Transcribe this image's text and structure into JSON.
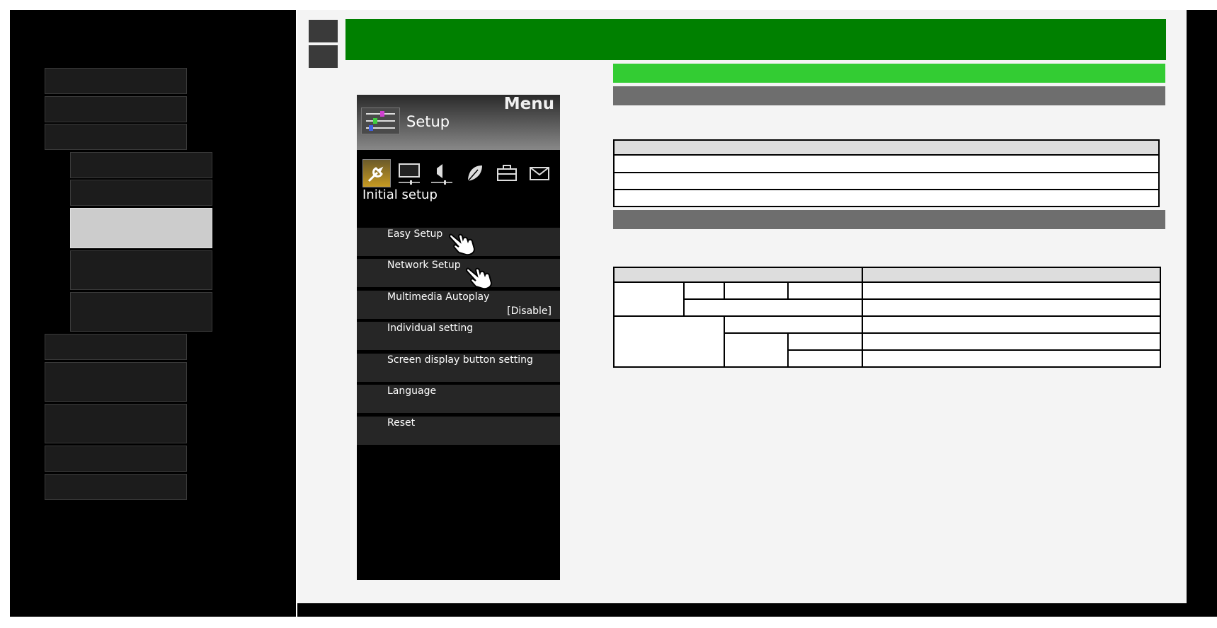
{
  "tv_menu": {
    "title": "Menu",
    "setup_label": "Setup",
    "section_label": "Initial setup",
    "categories": [
      "wrench-icon",
      "display-icon",
      "speaker-icon",
      "leaf-icon",
      "toolbox-icon",
      "mail-icon"
    ],
    "items": [
      {
        "label": "Easy Setup",
        "value": ""
      },
      {
        "label": "Network Setup",
        "value": ""
      },
      {
        "label": "Multimedia Autoplay",
        "value": "[Disable]"
      },
      {
        "label": "Individual setting",
        "value": ""
      },
      {
        "label": "Screen display button setting",
        "value": ""
      },
      {
        "label": "Language",
        "value": ""
      },
      {
        "label": "Reset",
        "value": ""
      }
    ]
  },
  "colors": {
    "header_green": "#008000",
    "sub_bar_green": "#33cc33",
    "section_gray": "#6e6e6e",
    "nav_selected": "#cccccc"
  }
}
